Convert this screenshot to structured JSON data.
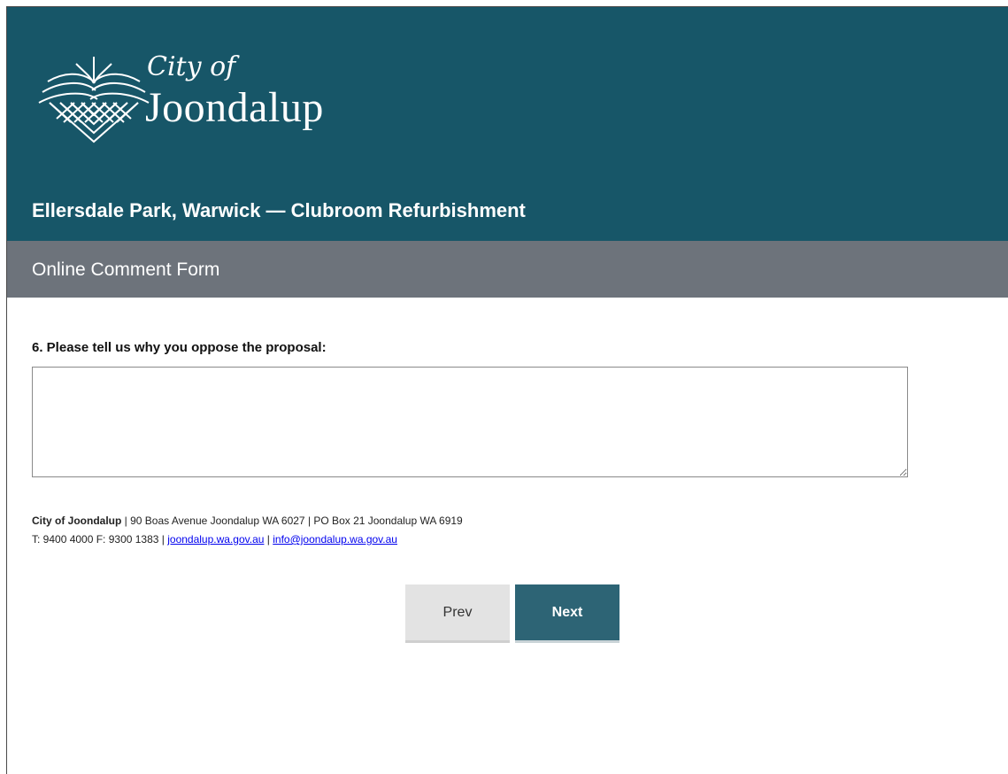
{
  "header": {
    "logo_line1": "City of",
    "logo_line2": "Joondalup",
    "project_title": "Ellersdale Park, Warwick — Clubroom Refurbishment",
    "background": "#175668"
  },
  "subbar": {
    "title": "Online Comment Form",
    "background": "#6d737b"
  },
  "question": {
    "label": "6. Please tell us why you oppose the proposal:",
    "value": ""
  },
  "footer": {
    "org": "City of Joondalup",
    "address": " | 90 Boas Avenue Joondalup WA 6027 | PO Box 21 Joondalup WA 6919",
    "phone": "T: 9400 4000 F: 9300 1383 | ",
    "website": "joondalup.wa.gov.au",
    "separator": " | ",
    "email": "info@joondalup.wa.gov.au"
  },
  "buttons": {
    "prev": "Prev",
    "next": "Next",
    "next_color": "#2d6475"
  }
}
